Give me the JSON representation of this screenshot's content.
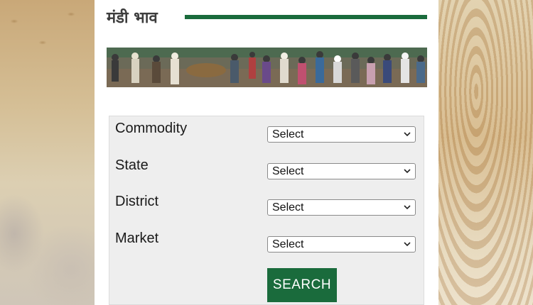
{
  "page": {
    "title": "मंडी भाव",
    "accent_color": "#1a6b3c"
  },
  "banner": {
    "icon": "market-crowd-photo"
  },
  "form": {
    "fields": [
      {
        "label": "Commodity",
        "value": "Select"
      },
      {
        "label": "State",
        "value": "Select"
      },
      {
        "label": "District",
        "value": "Select"
      },
      {
        "label": "Market",
        "value": "Select"
      }
    ],
    "search_label": "SEARCH"
  }
}
